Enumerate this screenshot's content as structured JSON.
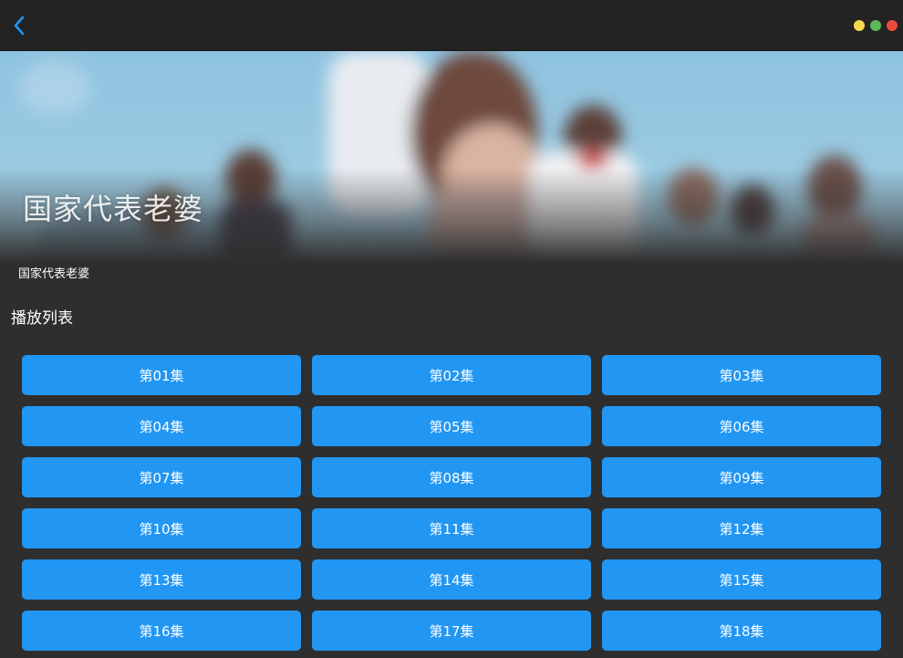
{
  "window": {
    "back_icon": "chevron-left-icon",
    "controls": [
      "minimize",
      "maximize",
      "close"
    ],
    "accent": "#2196f3"
  },
  "hero": {
    "title": "国家代表老婆"
  },
  "show": {
    "name": "国家代表老婆"
  },
  "playlist": {
    "label": "播放列表",
    "episodes": [
      "第01集",
      "第02集",
      "第03集",
      "第04集",
      "第05集",
      "第06集",
      "第07集",
      "第08集",
      "第09集",
      "第10集",
      "第11集",
      "第12集",
      "第13集",
      "第14集",
      "第15集",
      "第16集",
      "第17集",
      "第18集"
    ]
  }
}
